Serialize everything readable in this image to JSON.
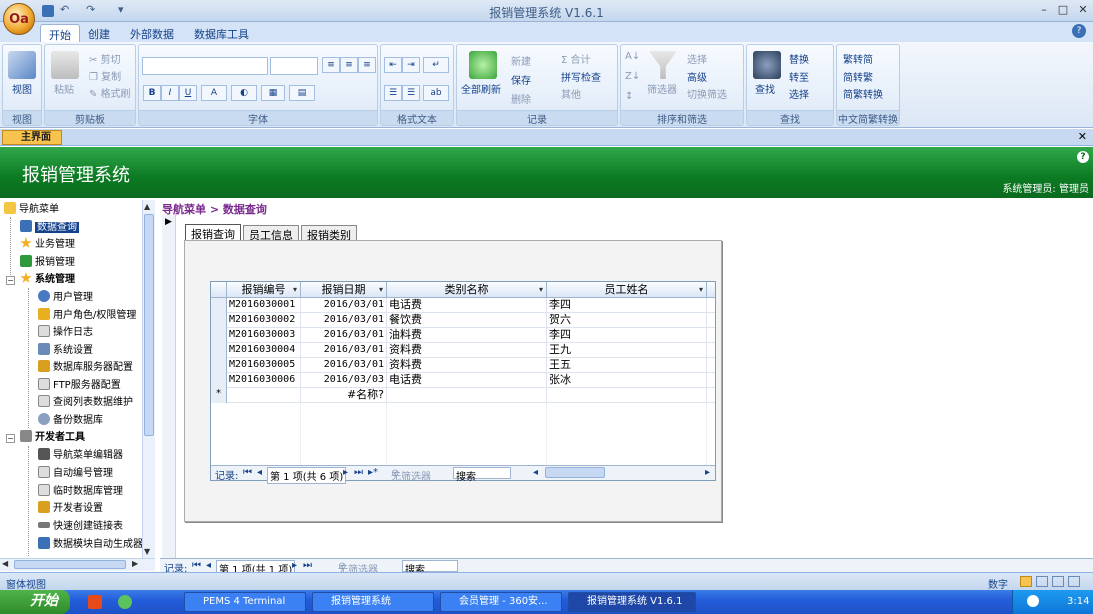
{
  "window": {
    "title": "报销管理系统 V1.6.1",
    "logo_text": "Oa"
  },
  "qat": {
    "undo": "↶",
    "redo": "↷",
    "customize": "▾"
  },
  "window_controls": {
    "minimize": "–",
    "maximize": "□",
    "close": "✕",
    "help": "?"
  },
  "ribbon_tabs": [
    "开始",
    "创建",
    "外部数据",
    "数据库工具"
  ],
  "ribbon": {
    "view": {
      "label": "视图",
      "group": "视图"
    },
    "clipboard": {
      "group": "剪贴板",
      "paste": "粘贴",
      "cut": "剪切",
      "copy": "复制",
      "format_painter": "格式刷"
    },
    "font": {
      "group": "字体",
      "bold": "B",
      "italic": "I",
      "underline": "U",
      "font_color": "A"
    },
    "rich_text": {
      "group": "格式文本"
    },
    "records": {
      "group": "记录",
      "refresh_all": "全部刷新",
      "new": "新建",
      "save": "保存",
      "delete": "删除",
      "totals": "合计",
      "spelling": "拼写检查",
      "more": "其他"
    },
    "sort_filter": {
      "group": "排序和筛选",
      "filter": "筛选器",
      "selection": "选择",
      "advanced": "高级",
      "toggle_filter": "切换筛选"
    },
    "find": {
      "group": "查找",
      "find": "查找",
      "replace": "替换",
      "goto": "转至",
      "select": "选择"
    },
    "chinese_convert": {
      "group": "中文简繁转换",
      "to_simplified": "繁转简",
      "to_traditional": "简转繁",
      "convert": "简繁转换"
    }
  },
  "doc_tab": {
    "label": "主界面"
  },
  "banner": {
    "title": "报销管理系统",
    "admin": "系统管理员: 管理员",
    "help": "?"
  },
  "nav": {
    "root": "导航菜单",
    "items": [
      {
        "label": "数据查询",
        "selected": true
      },
      {
        "label": "业务管理"
      },
      {
        "label": "报销管理"
      },
      {
        "label": "系统管理",
        "group": true
      },
      {
        "label": "用户管理"
      },
      {
        "label": "用户角色/权限管理"
      },
      {
        "label": "操作日志"
      },
      {
        "label": "系统设置"
      },
      {
        "label": "数据库服务器配置"
      },
      {
        "label": "FTP服务器配置"
      },
      {
        "label": "查阅列表数据维护"
      },
      {
        "label": "备份数据库"
      },
      {
        "label": "开发者工具",
        "group": true
      },
      {
        "label": "导航菜单编辑器"
      },
      {
        "label": "自动编号管理"
      },
      {
        "label": "临时数据库管理"
      },
      {
        "label": "开发者设置"
      },
      {
        "label": "快速创建链接表"
      },
      {
        "label": "数据模块自动生成器"
      }
    ],
    "expand_minus": "−"
  },
  "breadcrumb": "导航菜单 > 数据查询",
  "form_tabs": [
    "报销查询",
    "员工信息",
    "报销类别"
  ],
  "grid": {
    "columns": [
      "报销编号",
      "报销日期",
      "类别名称",
      "员工姓名"
    ],
    "rows": [
      [
        "M2016030001",
        "2016/03/01",
        "电话费",
        "李四"
      ],
      [
        "M2016030002",
        "2016/03/01",
        "餐饮费",
        "贺六"
      ],
      [
        "M2016030003",
        "2016/03/01",
        "油料费",
        "李四"
      ],
      [
        "M2016030004",
        "2016/03/01",
        "资料费",
        "王九"
      ],
      [
        "M2016030005",
        "2016/03/01",
        "资料费",
        "王五"
      ],
      [
        "M2016030006",
        "2016/03/03",
        "电话费",
        "张冰"
      ]
    ],
    "new_row_marker": "*",
    "new_row_placeholder": "#名称?",
    "nav": {
      "label": "记录:",
      "position": "第 1 项(共 6 项)",
      "filter": "无筛选器",
      "search": "搜索"
    }
  },
  "outer_nav": {
    "label": "记录:",
    "position": "第 1 项(共 1 项)",
    "filter": "无筛选器",
    "search": "搜索"
  },
  "status": {
    "left": "窗体视图",
    "mode": "数字"
  },
  "taskbar": {
    "start": "开始",
    "items": [
      "PEMS 4 Terminal",
      "报销管理系统",
      "会员管理 - 360安...",
      "报销管理系统 V1.6.1"
    ],
    "time": "3:14"
  }
}
